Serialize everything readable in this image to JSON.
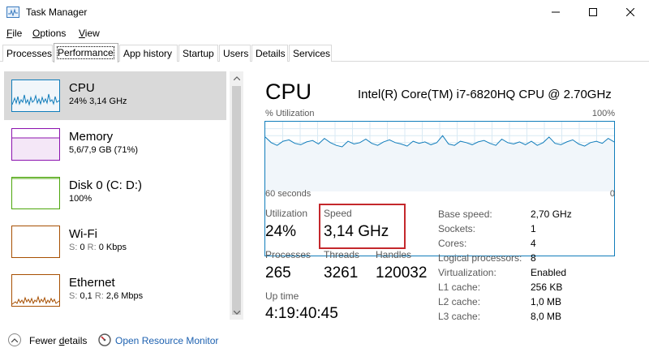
{
  "window": {
    "title": "Task Manager",
    "controls": {
      "minimize": "minimize-icon",
      "maximize": "maximize-icon",
      "close": "close-icon"
    }
  },
  "menu": [
    {
      "first": "F",
      "rest": "ile"
    },
    {
      "first": "O",
      "rest": "ptions"
    },
    {
      "first": "V",
      "rest": "iew"
    }
  ],
  "tabs": [
    "Processes",
    "Performance",
    "App history",
    "Startup",
    "Users",
    "Details",
    "Services"
  ],
  "active_tab": "Performance",
  "sidebar": [
    {
      "name": "CPU",
      "dim": "",
      "sub": "24% 3,14 GHz",
      "color": "#117dbb"
    },
    {
      "name": "Memory",
      "dim": "",
      "sub": "5,6/7,9 GB (71%)",
      "color": "#8b12ae"
    },
    {
      "name": "Disk 0 (C: D:)",
      "dim": "",
      "sub": "100%",
      "color": "#4da60c"
    },
    {
      "name": "Wi-Fi",
      "dim": "S:",
      "sub_s": "0",
      "dim2": "R:",
      "sub_r": "0 Kbps",
      "color": "#a74f01"
    },
    {
      "name": "Ethernet",
      "dim": "S:",
      "sub_s": "0,1",
      "dim2": "R:",
      "sub_r": "2,6 Mbps",
      "color": "#a74f01"
    }
  ],
  "cpu": {
    "title": "CPU",
    "model": "Intel(R) Core(TM) i7-6820HQ CPU @ 2.70GHz",
    "graph_label": "% Utilization",
    "graph_max": "100%",
    "time_left": "60 seconds",
    "time_right": "0",
    "utilization_label": "Utilization",
    "utilization": "24%",
    "speed_label": "Speed",
    "speed": "3,14 GHz",
    "processes_label": "Processes",
    "processes": "265",
    "threads_label": "Threads",
    "threads": "3261",
    "handles_label": "Handles",
    "handles": "120032",
    "uptime_label": "Up time",
    "uptime": "4:19:40:45",
    "info": [
      {
        "label": "Base speed:",
        "value": "2,70 GHz"
      },
      {
        "label": "Sockets:",
        "value": "1"
      },
      {
        "label": "Cores:",
        "value": "4"
      },
      {
        "label": "Logical processors:",
        "value": "8"
      },
      {
        "label": "Virtualization:",
        "value": "Enabled"
      },
      {
        "label": "L1 cache:",
        "value": "256 KB"
      },
      {
        "label": "L2 cache:",
        "value": "1,0 MB"
      },
      {
        "label": "L3 cache:",
        "value": "8,0 MB"
      }
    ],
    "history": [
      78,
      70,
      66,
      72,
      74,
      69,
      67,
      71,
      73,
      68,
      76,
      70,
      66,
      64,
      72,
      68,
      70,
      75,
      69,
      66,
      71,
      74,
      70,
      68,
      65,
      72,
      69,
      71,
      67,
      70,
      80,
      68,
      66,
      72,
      70,
      67,
      71,
      73,
      69,
      66,
      75,
      70,
      68,
      71,
      67,
      72,
      66,
      70,
      78,
      69,
      67,
      71,
      74,
      68,
      65,
      70,
      72,
      69,
      76,
      71
    ]
  },
  "bottom": {
    "fewer_first": "Fewer ",
    "fewer_u": "d",
    "fewer_rest": "etails",
    "open_resource": "Open Resource Monitor"
  },
  "colors": {
    "cpu_line": "#117dbb",
    "cpu_fill": "#f1f6fa",
    "highlight": "#c4282c",
    "link": "#1d61b0"
  }
}
